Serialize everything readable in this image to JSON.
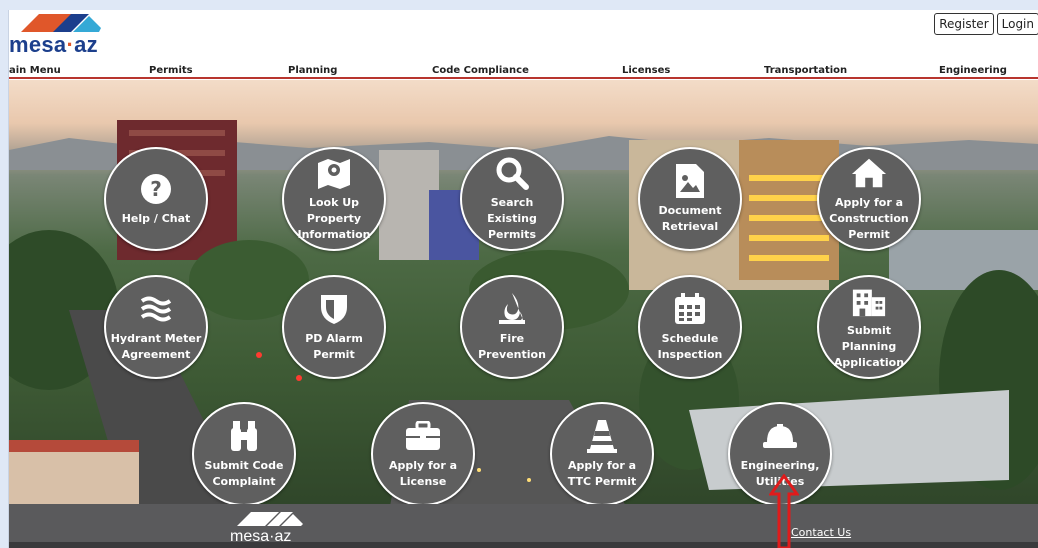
{
  "brand": {
    "logo_text_a": "mesa",
    "logo_dot": "·",
    "logo_text_b": "az"
  },
  "auth": {
    "register": "Register",
    "login": "Login"
  },
  "nav": [
    "ain Menu",
    "Permits",
    "Planning",
    "Code Compliance",
    "Licenses",
    "Transportation",
    "Engineering"
  ],
  "tiles": [
    {
      "label": "Help / Chat",
      "icon": "question-circle-icon"
    },
    {
      "label": "Look Up Property Information",
      "icon": "map-pin-icon"
    },
    {
      "label": "Search Existing Permits",
      "icon": "search-icon"
    },
    {
      "label": "Document Retrieval",
      "icon": "document-image-icon"
    },
    {
      "label": "Apply for a Construction Permit",
      "icon": "house-icon"
    },
    {
      "label": "Hydrant Meter Agreement",
      "icon": "water-waves-icon"
    },
    {
      "label": "PD Alarm Permit",
      "icon": "shield-icon"
    },
    {
      "label": "Fire Prevention",
      "icon": "flame-icon"
    },
    {
      "label": "Schedule Inspection",
      "icon": "calendar-icon"
    },
    {
      "label": "Submit Planning Application",
      "icon": "building-icon"
    },
    {
      "label": "Submit Code Complaint",
      "icon": "binoculars-icon"
    },
    {
      "label": "Apply for a License",
      "icon": "briefcase-icon"
    },
    {
      "label": "Apply for a TTC Permit",
      "icon": "traffic-cone-icon"
    },
    {
      "label": "Engineering, Utilities",
      "icon": "hard-hat-icon"
    }
  ],
  "footer": {
    "logo_text": "mesa·az",
    "contact": "Contact Us"
  },
  "colors": {
    "accent_red": "#b8352e",
    "logo_blue": "#1c3f8c",
    "logo_orange": "#e0572a",
    "tile_gray": "#5f5f5f",
    "footer_gray": "#5a5a5c"
  }
}
